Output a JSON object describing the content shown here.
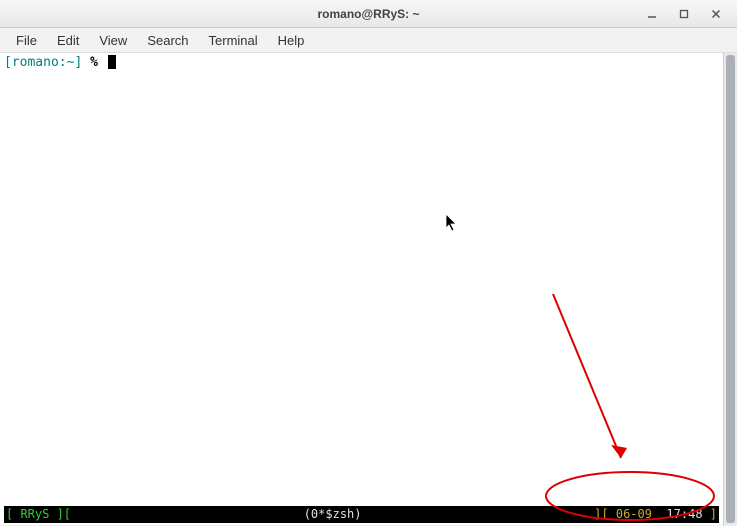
{
  "window": {
    "title": "romano@RRyS: ~"
  },
  "menu": {
    "file": "File",
    "edit": "Edit",
    "view": "View",
    "search": "Search",
    "terminal": "Terminal",
    "help": "Help"
  },
  "prompt": {
    "open": "[",
    "user": "romano",
    "sep": ":",
    "path": "~",
    "close": "]",
    "symbol": " % "
  },
  "status": {
    "left_open": "[ ",
    "host": "RRyS",
    "left_close": " ][",
    "center": "(0*$zsh)",
    "right_open": "][ ",
    "date": "06-09",
    "time": "17:48",
    "right_close": " ]"
  },
  "icons": {
    "minimize": "minimize-icon",
    "maximize": "maximize-icon",
    "close": "close-icon"
  }
}
